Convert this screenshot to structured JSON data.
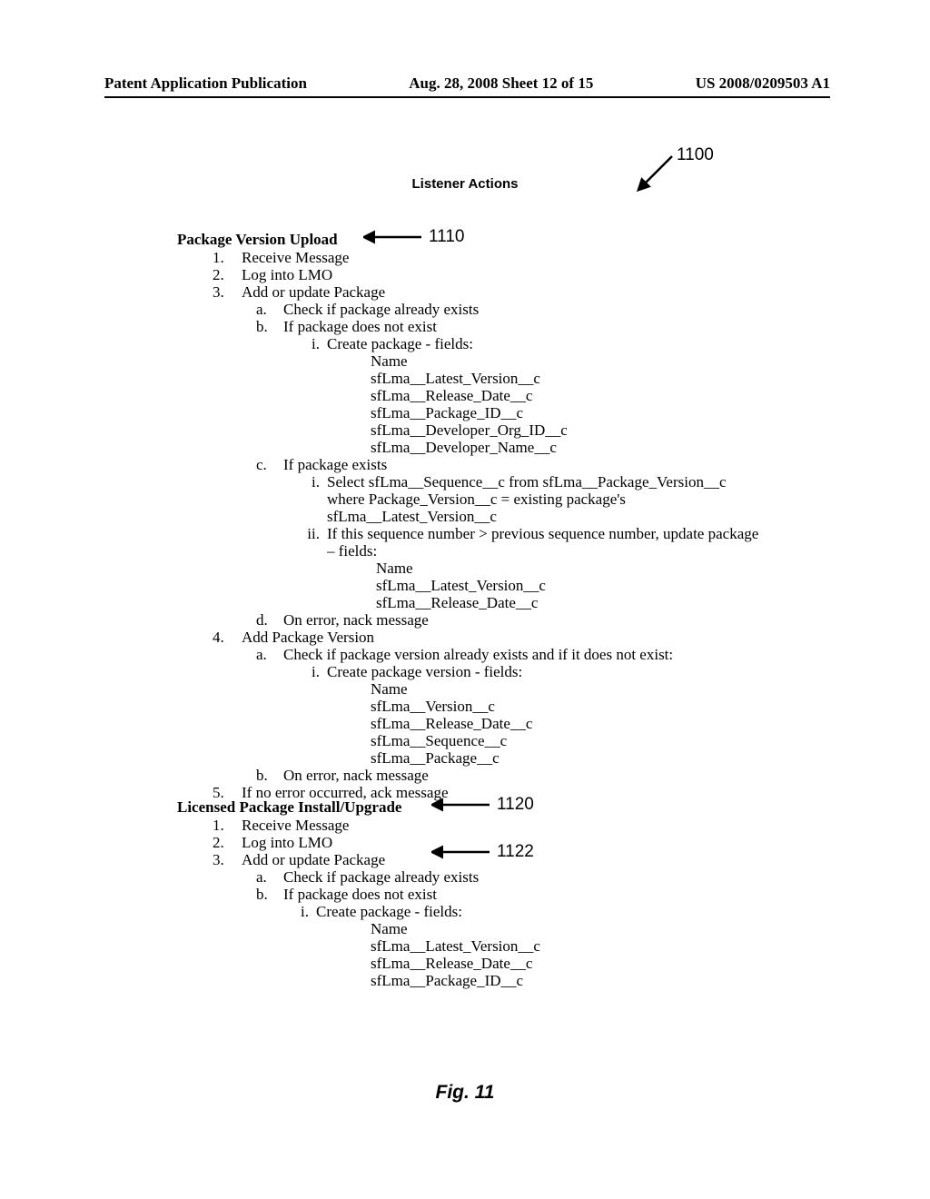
{
  "header": {
    "left": "Patent Application Publication",
    "center": "Aug. 28, 2008  Sheet 12 of 15",
    "right": "US 2008/0209503 A1"
  },
  "title": "Listener Actions",
  "labels": {
    "l1100": "1100",
    "l1110": "1110",
    "l1120": "1120",
    "l1122": "1122"
  },
  "upload": {
    "heading": "Package Version Upload",
    "s1": "Receive Message",
    "s2": "Log into LMO",
    "s3": "Add or update Package",
    "s3a": "Check if package already exists",
    "s3b": "If package does not exist",
    "s3bi": "Create package - fields:",
    "s3bi_f": [
      "Name",
      "sfLma__Latest_Version__c",
      "sfLma__Release_Date__c",
      "sfLma__Package_ID__c",
      "sfLma__Developer_Org_ID__c",
      "sfLma__Developer_Name__c"
    ],
    "s3c": "If package exists",
    "s3ci_l1": "Select sfLma__Sequence__c from sfLma__Package_Version__c",
    "s3ci_l2": "where Package_Version__c = existing package's",
    "s3ci_l3": "sfLma__Latest_Version__c",
    "s3cii_l1": "If this sequence number > previous sequence number, update package",
    "s3cii_l2": "– fields:",
    "s3cii_f": [
      "Name",
      "sfLma__Latest_Version__c",
      "sfLma__Release_Date__c"
    ],
    "s3d": "On error, nack message",
    "s4": "Add Package Version",
    "s4a": "Check if package version already exists and if it does not exist:",
    "s4ai": "Create package version - fields:",
    "s4ai_f": [
      "Name",
      "sfLma__Version__c",
      "sfLma__Release_Date__c",
      "sfLma__Sequence__c",
      "sfLma__Package__c"
    ],
    "s4b": "On error, nack message",
    "s5": "If no error occurred, ack message"
  },
  "install": {
    "heading": "Licensed Package Install/Upgrade",
    "s1": "Receive Message",
    "s2": "Log into LMO",
    "s3": "Add or update Package",
    "s3a": "Check if package already exists",
    "s3b": "If package does not exist",
    "s3bi": "Create package - fields:",
    "s3bi_f": [
      "Name",
      "sfLma__Latest_Version__c",
      "sfLma__Release_Date__c",
      "sfLma__Package_ID__c"
    ]
  },
  "figure": "Fig. 11"
}
